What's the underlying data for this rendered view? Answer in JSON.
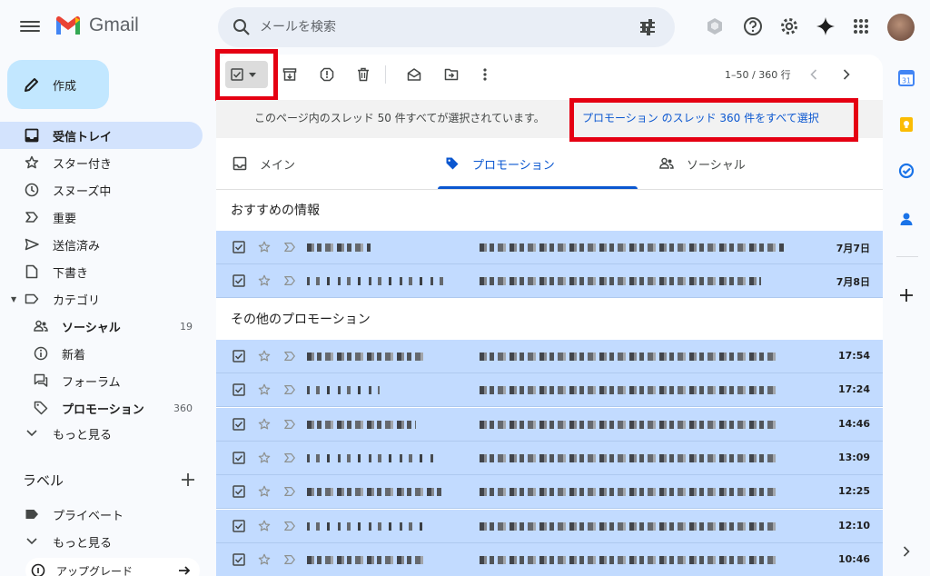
{
  "app": {
    "name": "Gmail"
  },
  "search": {
    "placeholder": "メールを検索"
  },
  "sidebar": {
    "compose_label": "作成",
    "items": [
      {
        "label": "受信トレイ",
        "icon": "inbox-icon",
        "active": true
      },
      {
        "label": "スター付き",
        "icon": "star-icon"
      },
      {
        "label": "スヌーズ中",
        "icon": "clock-icon"
      },
      {
        "label": "重要",
        "icon": "important-icon"
      },
      {
        "label": "送信済み",
        "icon": "send-icon"
      },
      {
        "label": "下書き",
        "icon": "draft-icon"
      },
      {
        "label": "カテゴリ",
        "icon": "label-icon"
      }
    ],
    "categories": [
      {
        "label": "ソーシャル",
        "count": "19",
        "icon": "people-icon"
      },
      {
        "label": "新着",
        "icon": "info-icon"
      },
      {
        "label": "フォーラム",
        "icon": "forum-icon"
      },
      {
        "label": "プロモーション",
        "count": "360",
        "icon": "tag-icon"
      },
      {
        "label": "もっと見る",
        "icon": "chevron-down-icon"
      }
    ],
    "labels_heading": "ラベル",
    "labels": [
      {
        "label": "プライベート",
        "icon": "label-filled-icon"
      },
      {
        "label": "もっと見る",
        "icon": "chevron-down-icon"
      }
    ],
    "upgrade_label": "アップグレード"
  },
  "toolbar": {
    "page_info": "1–50 / 360 行"
  },
  "banner": {
    "text": "このページ内のスレッド 50 件すべてが選択されています。",
    "link": "プロモーション のスレッド 360 件をすべて選択"
  },
  "tabs": [
    {
      "label": "メイン",
      "icon": "inbox-icon"
    },
    {
      "label": "プロモーション",
      "icon": "tag-icon",
      "active": true
    },
    {
      "label": "ソーシャル",
      "icon": "people-icon"
    }
  ],
  "sections": {
    "recommended": "おすすめの情報",
    "other": "その他のプロモーション"
  },
  "recommended_dates": [
    "7月7日",
    "7月8日"
  ],
  "other_dates": [
    "17:54",
    "17:24",
    "14:46",
    "13:09",
    "12:25",
    "12:10",
    "10:46"
  ],
  "colors": {
    "accent": "#0b57d0",
    "selected_row": "#c2dbff",
    "highlight": "#e50012"
  }
}
